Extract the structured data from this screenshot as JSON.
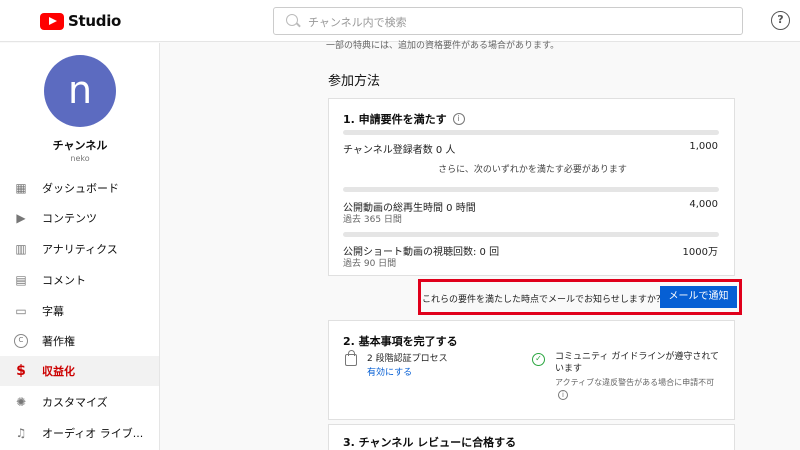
{
  "header": {
    "app_name": "Studio",
    "search_placeholder": "チャンネル内で検索",
    "help_glyph": "?"
  },
  "sidebar": {
    "avatar_letter": "n",
    "channel_name": "チャンネル",
    "channel_handle": "neko",
    "items": [
      {
        "label": "ダッシュボード",
        "icon": "dashboard-icon",
        "glyph": "▦"
      },
      {
        "label": "コンテンツ",
        "icon": "content-icon",
        "glyph": "▶"
      },
      {
        "label": "アナリティクス",
        "icon": "analytics-icon",
        "glyph": "▥"
      },
      {
        "label": "コメント",
        "icon": "comments-icon",
        "glyph": "▤"
      },
      {
        "label": "字幕",
        "icon": "subtitles-icon",
        "glyph": "▭"
      },
      {
        "label": "著作権",
        "icon": "copyright-icon",
        "glyph": "C"
      },
      {
        "label": "収益化",
        "icon": "monetization-icon",
        "glyph": "$"
      },
      {
        "label": "カスタマイズ",
        "icon": "customize-icon",
        "glyph": "✺"
      },
      {
        "label": "オーディオ ライブ...",
        "icon": "audio-library-icon",
        "glyph": "♫"
      }
    ]
  },
  "main": {
    "top_text": "一部の特典には、追加の資格要件がある場合があります。",
    "section_title": "参加方法",
    "requirements": {
      "title": "1. 申請要件を満たす",
      "or_text": "さらに、次のいずれかを満たす必要があります",
      "items": [
        {
          "label": "チャンネル登録者数 0 人",
          "target": "1,000",
          "sub": "",
          "progress": 0
        },
        {
          "label": "公開動画の総再生時間 0 時間",
          "target": "4,000",
          "sub": "過去 365 日間",
          "progress": 0
        },
        {
          "label": "公開ショート動画の視聴回数: 0 回",
          "target": "1000万",
          "sub": "過去 90 日間",
          "progress": 0
        }
      ]
    },
    "notify": {
      "text": "これらの要件を満たした時点でメールでお知らせしますか？",
      "button": "メールで通知"
    },
    "basics": {
      "title": "2. 基本事項を完了する",
      "two_step": "2 段階認証プロセス",
      "enable_link": "有効にする",
      "guidelines": "コミュニティ ガイドラインが遵守されています",
      "guidelines_note": "アクティブな違反警告がある場合に申請不可"
    },
    "review": {
      "title": "3. チャンネル レビューに合格する"
    }
  },
  "colors": {
    "accent": "#065fd4",
    "brand": "#ff0000",
    "highlight": "#e0001b",
    "active_nav": "#cc0000"
  }
}
